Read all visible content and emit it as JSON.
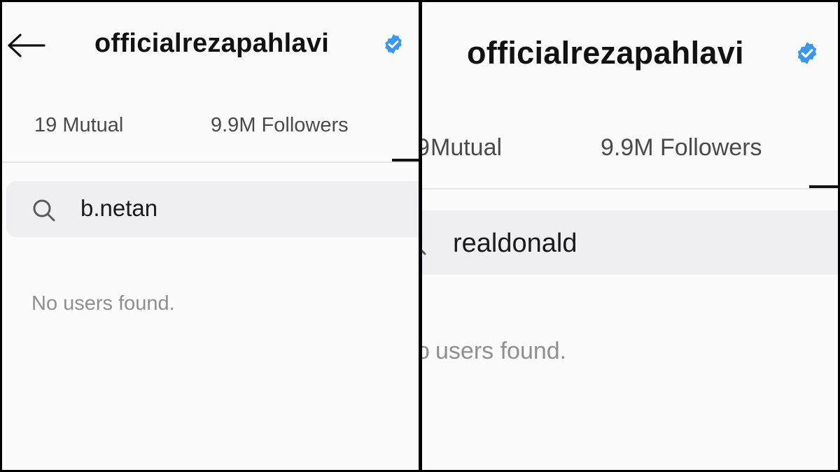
{
  "left_panel": {
    "username": "officialrezapahlavi",
    "tabs": {
      "mutual": "19 Mutual",
      "followers": "9.9M Followers"
    },
    "search": {
      "query": "b.netan"
    },
    "empty_message": "No users found."
  },
  "right_panel": {
    "username": "officialrezapahlavi",
    "tabs": {
      "mutual": "Mutual",
      "followers": "9.9M Followers"
    },
    "search": {
      "query": "realdonald"
    },
    "empty_message": "users found."
  },
  "colors": {
    "verified_blue": "#3897f0",
    "background": "#fbfbfc",
    "search_bg": "#efeff1",
    "muted_text": "#8f8f8f"
  },
  "icons": [
    "back-arrow-icon",
    "verified-badge-icon",
    "search-icon"
  ]
}
